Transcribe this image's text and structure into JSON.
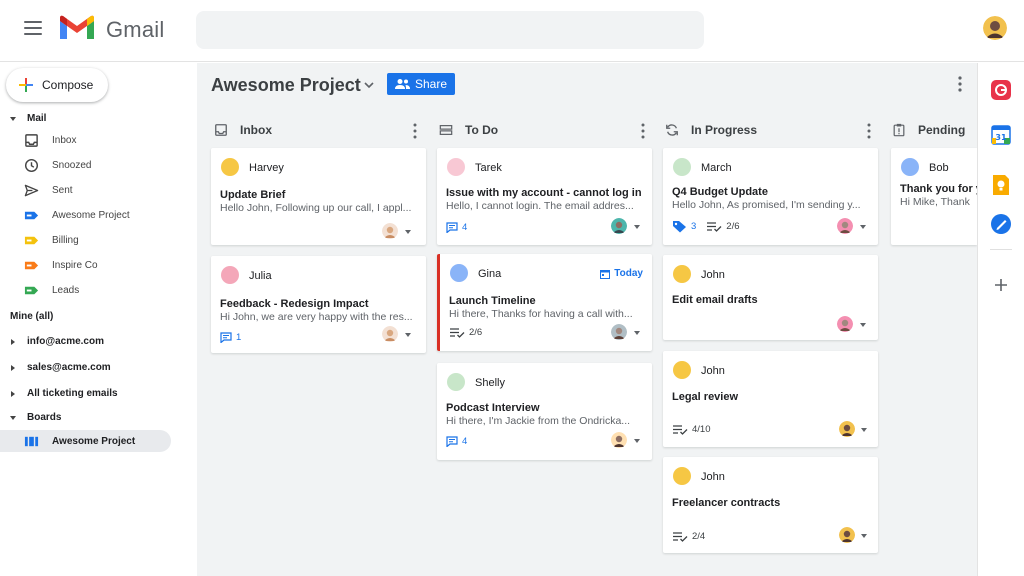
{
  "header": {
    "brand": "Gmail",
    "search_value": ""
  },
  "sidebar": {
    "compose_label": "Compose",
    "mail_section": "Mail",
    "mail_items": [
      {
        "label": "Inbox",
        "icon": "inbox-icon"
      },
      {
        "label": "Snoozed",
        "icon": "clock-icon"
      },
      {
        "label": "Sent",
        "icon": "send-icon"
      },
      {
        "label": "Awesome Project",
        "icon": "label-icon",
        "color": "#1a73e8"
      },
      {
        "label": "Billing",
        "icon": "label-icon",
        "color": "#f4c20d"
      },
      {
        "label": "Inspire Co",
        "icon": "label-icon",
        "color": "#fa7b17"
      },
      {
        "label": "Leads",
        "icon": "label-icon",
        "color": "#34a853"
      }
    ],
    "mine_label": "Mine (all)",
    "accounts": [
      "info@acme.com",
      "sales@acme.com",
      "All ticketing emails"
    ],
    "boards_section": "Boards",
    "boards": [
      {
        "label": "Awesome Project",
        "icon": "board-icon",
        "active": true
      }
    ]
  },
  "board": {
    "title": "Awesome Project",
    "share_label": "Share",
    "columns": [
      {
        "title": "Inbox",
        "icon": "inbox-icon",
        "cards": [
          {
            "name": "Harvey",
            "avatar_color": "#f6c744",
            "subject": "Update Brief",
            "preview": "Hello John, Following up our call, I appl...",
            "comments": ""
          },
          {
            "name": "Julia",
            "avatar_color": "#f4a7b9",
            "subject": "Feedback - Redesign Impact",
            "preview": "Hi John, we are very happy with the res...",
            "comments": "1"
          }
        ]
      },
      {
        "title": "To Do",
        "icon": "board-list-icon",
        "cards": [
          {
            "name": "Tarek",
            "avatar_color": "#f8c8d4",
            "subject": "Issue with my account - cannot log in",
            "preview": "Hello, I cannot login. The email addres...",
            "comments": "4"
          },
          {
            "name": "Gina",
            "avatar_color": "#8ab4f8",
            "subject": "Launch Timeline",
            "preview": "Hi there, Thanks for having a call with...",
            "due": "Today",
            "tasks": "2/6"
          },
          {
            "name": "Shelly",
            "avatar_color": "#c8e6c9",
            "subject": "Podcast Interview",
            "preview": "Hi there, I'm Jackie from the Ondricka...",
            "comments": "4"
          }
        ]
      },
      {
        "title": "In Progress",
        "icon": "sync-icon",
        "cards": [
          {
            "name": "March",
            "avatar_color": "#c8e6c9",
            "subject": "Q4 Budget Update",
            "preview": "Hello John, As promised, I'm sending y...",
            "tags": "3",
            "tasks": "2/6"
          },
          {
            "name": "John",
            "avatar_color": "#f6c744",
            "subject": "Edit email drafts"
          },
          {
            "name": "John",
            "avatar_color": "#f6c744",
            "subject": "Legal review",
            "tasks": "4/10"
          },
          {
            "name": "John",
            "avatar_color": "#f6c744",
            "subject": "Freelancer contracts",
            "tasks": "2/4"
          }
        ]
      },
      {
        "title": "Pending",
        "icon": "pending-icon",
        "cards": [
          {
            "name": "Bob",
            "avatar_color": "#8ab4f8",
            "subject": "Thank you for y",
            "preview": "Hi Mike, Thank"
          }
        ]
      }
    ]
  },
  "rail": {
    "apps": [
      {
        "icon": "drag-app-icon",
        "color": "#e8334a"
      },
      {
        "icon": "calendar-icon",
        "color": "#1a73e8"
      },
      {
        "icon": "keep-icon",
        "color": "#f9ab00"
      },
      {
        "icon": "tasks-icon",
        "color": "#1a73e8"
      }
    ],
    "add_icon": "plus-icon"
  }
}
